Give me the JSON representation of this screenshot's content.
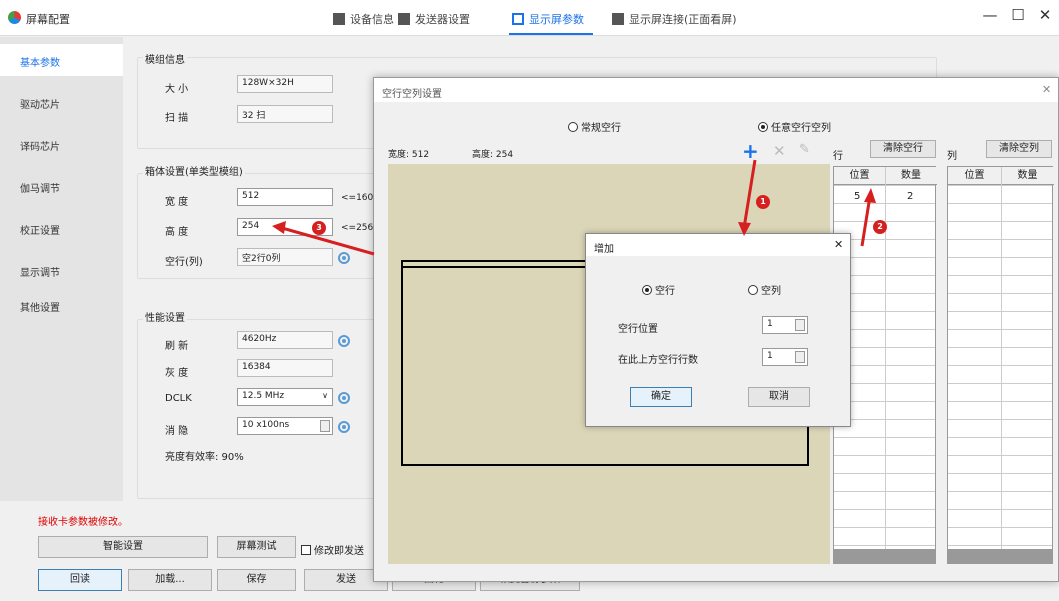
{
  "app": {
    "title": "屏幕配置"
  },
  "tabs": [
    {
      "label": "设备信息"
    },
    {
      "label": "发送器设置"
    },
    {
      "label": "显示屏参数"
    },
    {
      "label": "显示屏连接(正面看屏)"
    }
  ],
  "window_controls": {
    "minimize": "—",
    "maximize": "☐",
    "close": "✕"
  },
  "sidebar": {
    "items": [
      {
        "label": "基本参数"
      },
      {
        "label": "驱动芯片"
      },
      {
        "label": "译码芯片"
      },
      {
        "label": "伽马调节"
      },
      {
        "label": "校正设置"
      },
      {
        "label": "显示调节"
      },
      {
        "label": "其他设置"
      }
    ]
  },
  "module": {
    "title": "模组信息",
    "size_label": "大 小",
    "size_value": "128W×32H",
    "scan_label": "扫 描",
    "scan_value": "32 扫"
  },
  "cabinet": {
    "title": "箱体设置(单类型模组)",
    "width_label": "宽 度",
    "width_value": "512",
    "width_hint": "<=1604",
    "height_label": "高 度",
    "height_value": "254",
    "height_hint": "<=256",
    "blank_label": "空行(列)",
    "blank_value": "空2行0列"
  },
  "perf": {
    "title": "性能设置",
    "refresh_label": "刷 新",
    "refresh_value": "4620Hz",
    "gray_label": "灰 度",
    "gray_value": "16384",
    "dclk_label": "DCLK",
    "dclk_value": "12.5 MHz",
    "blank_label": "消 隐",
    "blank_value": "10 x100ns",
    "efficiency": "亮度有效率: 90%"
  },
  "bottom": {
    "warning": "接收卡参数被修改。",
    "smart_btn": "智能设置",
    "test_btn": "屏幕测试",
    "send_on_change": "修改即发送",
    "read_btn": "回读",
    "load_btn": "加载...",
    "save_btn": "保存",
    "send_btn": "发送",
    "solidify_btn": "固化",
    "restore_btn": "恢复备份参数"
  },
  "blank_dialog": {
    "title": "空行空列设置",
    "close": "✕",
    "mode_normal": "常规空行",
    "mode_any": "任意空行空列",
    "width_label": "宽度: 512",
    "height_label": "高度: 254",
    "row_label": "行",
    "clear_rows": "清除空行",
    "col_label": "列",
    "clear_cols": "清除空列",
    "row_table": {
      "headers": [
        "位置",
        "数量"
      ],
      "rows": [
        [
          "5",
          "2"
        ]
      ]
    },
    "col_table": {
      "headers": [
        "位置",
        "数量"
      ]
    }
  },
  "add_dialog": {
    "title": "增加",
    "close": "✕",
    "opt_row": "空行",
    "opt_col": "空列",
    "pos_label": "空行位置",
    "pos_value": "1",
    "count_label": "在此上方空行行数",
    "count_value": "1",
    "ok": "确定",
    "cancel": "取消"
  },
  "annotations": [
    "1",
    "2",
    "3"
  ],
  "colors": {
    "accent": "#1a73e8",
    "annotation": "#d62020",
    "canvas": "#dcd6b8"
  }
}
